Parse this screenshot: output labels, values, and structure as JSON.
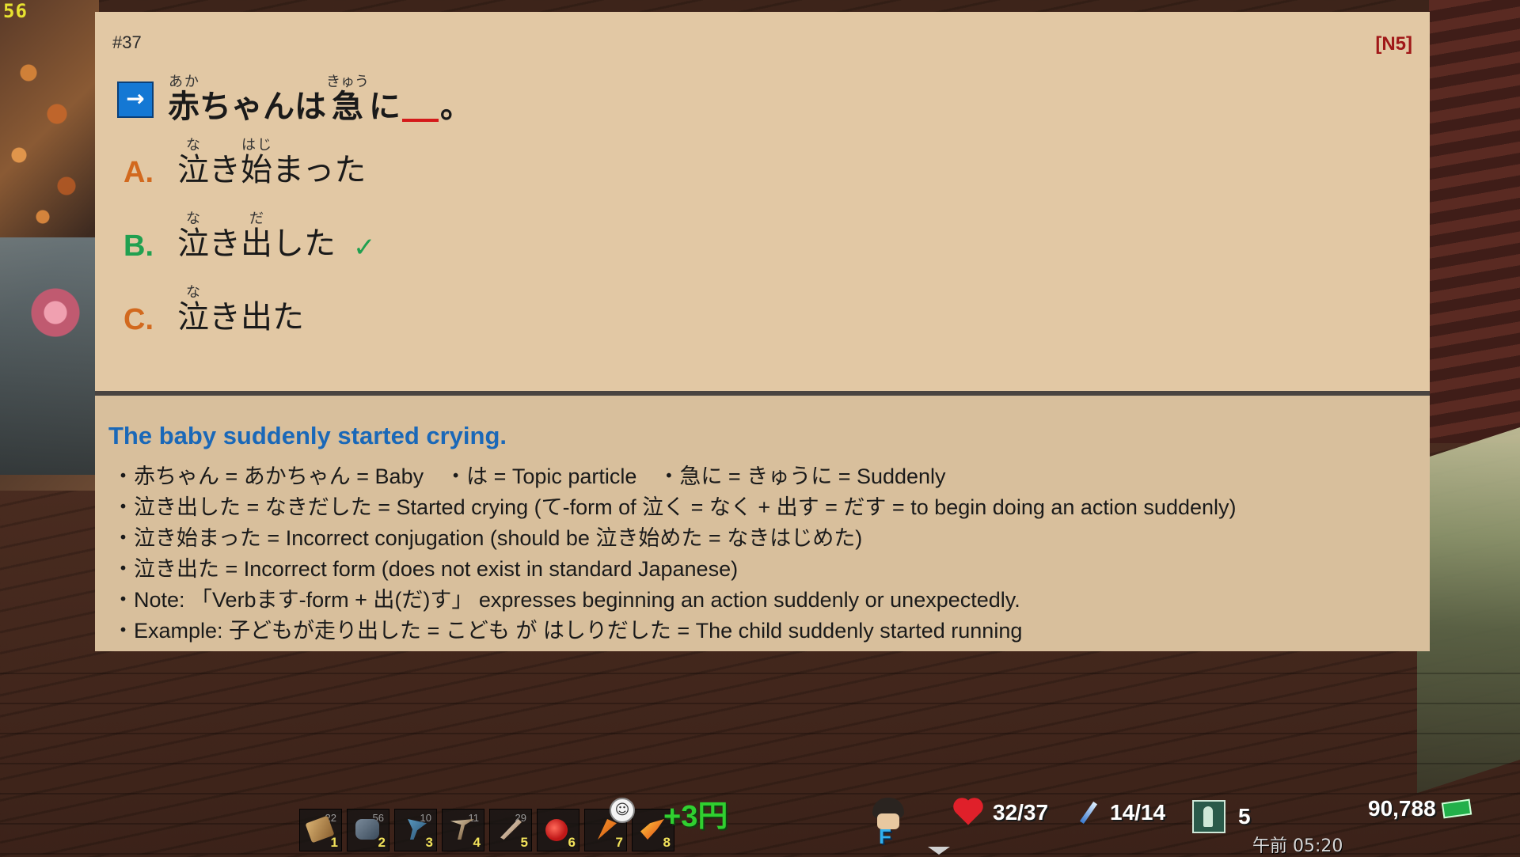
{
  "hud": {
    "fps": "56",
    "money_gain": "+3円",
    "hp": "32/37",
    "stamina": "14/14",
    "level": "5",
    "gold": "90,788",
    "clock": "午前 05:20",
    "action_key": "F"
  },
  "quiz": {
    "number": "#37",
    "level": "[N5]",
    "arrow_label": "→",
    "question": {
      "kanji1": "赤",
      "kanji1_reading": "あか",
      "part1": "ちゃんは",
      "kanji2": "急",
      "kanji2_reading": "きゅう",
      "part2": "に",
      "end": "。"
    },
    "options": [
      {
        "letter": "A.",
        "letter_color": "#d2691e",
        "k1": "泣",
        "k1_reading": "な",
        "mid": "き",
        "k2": "始",
        "k2_reading": "はじ",
        "tail": "まった",
        "correct": false
      },
      {
        "letter": "B.",
        "letter_color": "#20a050",
        "k1": "泣",
        "k1_reading": "な",
        "mid": "き",
        "k2": "出",
        "k2_reading": "だ",
        "tail": "した",
        "correct": true
      },
      {
        "letter": "C.",
        "letter_color": "#d2691e",
        "k1": "泣",
        "k1_reading": "な",
        "rest": "き出た",
        "correct": false
      }
    ],
    "check_mark": "✓",
    "translation": "The baby suddenly started crying.",
    "notes": [
      "・赤ちゃん = あかちゃん = Baby　・は = Topic particle　・急に = きゅうに = Suddenly",
      "・泣き出した = なきだした = Started crying (て-form of 泣く = なく + 出す = だす = to begin doing an action suddenly)",
      "・泣き始まった = Incorrect conjugation (should be 泣き始めた = なきはじめた)",
      "・泣き出た = Incorrect form (does not exist in standard Japanese)",
      "・Note: 「Verbます-form + 出(だ)す」 expresses beginning an action suddenly or unexpectedly.",
      "・Example: 子どもが走り出した = こども が はしりだした = The child suddenly started running"
    ]
  },
  "hotbar": [
    {
      "key": "1",
      "count": "22",
      "icon": "wood-plank-icon"
    },
    {
      "key": "2",
      "count": "56",
      "icon": "stone-icon"
    },
    {
      "key": "3",
      "count": "10",
      "icon": "axe-icon"
    },
    {
      "key": "4",
      "count": "11",
      "icon": "pickaxe-icon"
    },
    {
      "key": "5",
      "count": "29",
      "icon": "sword-icon"
    },
    {
      "key": "6",
      "count": "",
      "icon": "apple-icon"
    },
    {
      "key": "7",
      "count": "",
      "icon": "carrot-icon"
    },
    {
      "key": "8",
      "count": "",
      "icon": "fire-rod-icon"
    }
  ]
}
